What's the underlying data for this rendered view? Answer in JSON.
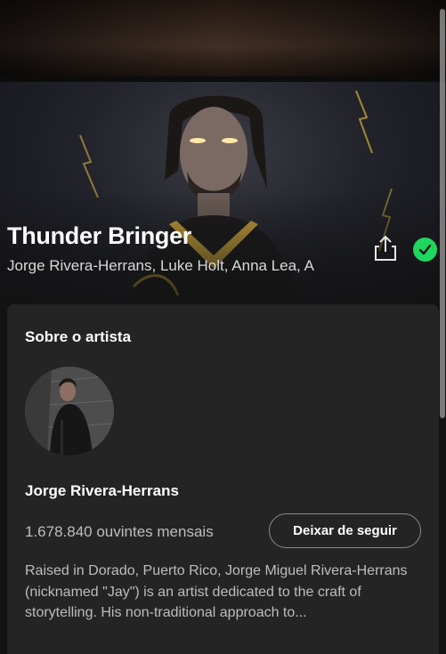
{
  "track": {
    "title": "Thunder Bringer",
    "artists": "Jorge Rivera-Herrans, Luke Holt, Anna Lea, A"
  },
  "actions": {
    "share_icon": "share-icon",
    "saved_icon": "check-circle-icon",
    "saved_color": "#1ed760"
  },
  "about": {
    "heading": "Sobre o artista",
    "artist_name": "Jorge Rivera-Herrans",
    "monthly_listeners": "1.678.840 ouvintes mensais",
    "follow_button_label": "Deixar de seguir",
    "bio": "Raised in Dorado, Puerto Rico, Jorge Miguel Rivera-Herrans (nicknamed \"Jay\") is an artist dedicated to the craft of storytelling. His non-traditional approach to..."
  },
  "colors": {
    "background": "#121212",
    "card": "#242424",
    "accent": "#1ed760"
  }
}
